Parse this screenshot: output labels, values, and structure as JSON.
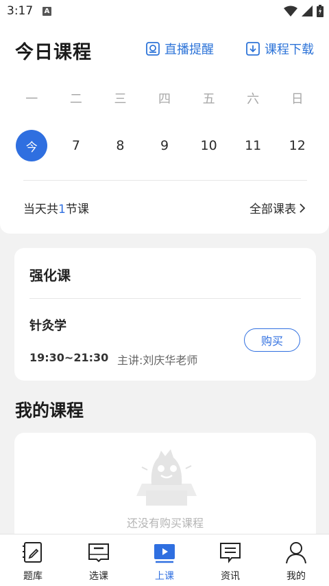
{
  "status_bar": {
    "time": "3:17",
    "notification_badge": "A"
  },
  "header": {
    "title": "今日课程",
    "live_reminder_label": "直播提醒",
    "course_download_label": "课程下载"
  },
  "calendar": {
    "weekdays": [
      "一",
      "二",
      "三",
      "四",
      "五",
      "六",
      "日"
    ],
    "dates": [
      "今",
      "7",
      "8",
      "9",
      "10",
      "11",
      "12"
    ],
    "today_index": 0,
    "summary_prefix": "当天共",
    "summary_count": "1",
    "summary_suffix": "节课",
    "all_schedule_label": "全部课表"
  },
  "intensive_section": {
    "title": "强化课",
    "course": {
      "name": "针灸学",
      "time": "19:30~21:30",
      "teacher": "主讲:刘庆华老师",
      "buy_label": "购买"
    }
  },
  "my_courses": {
    "title": "我的课程",
    "empty_text": "还没有购买课程"
  },
  "tabbar": {
    "items": [
      {
        "label": "题库",
        "icon": "question-bank-icon"
      },
      {
        "label": "选课",
        "icon": "course-select-icon"
      },
      {
        "label": "上课",
        "icon": "play-class-icon"
      },
      {
        "label": "资讯",
        "icon": "news-icon"
      },
      {
        "label": "我的",
        "icon": "profile-icon"
      }
    ],
    "active_index": 2
  },
  "colors": {
    "accent": "#2f6fe0",
    "link": "#2e74d8",
    "background": "#f2f2f2"
  }
}
